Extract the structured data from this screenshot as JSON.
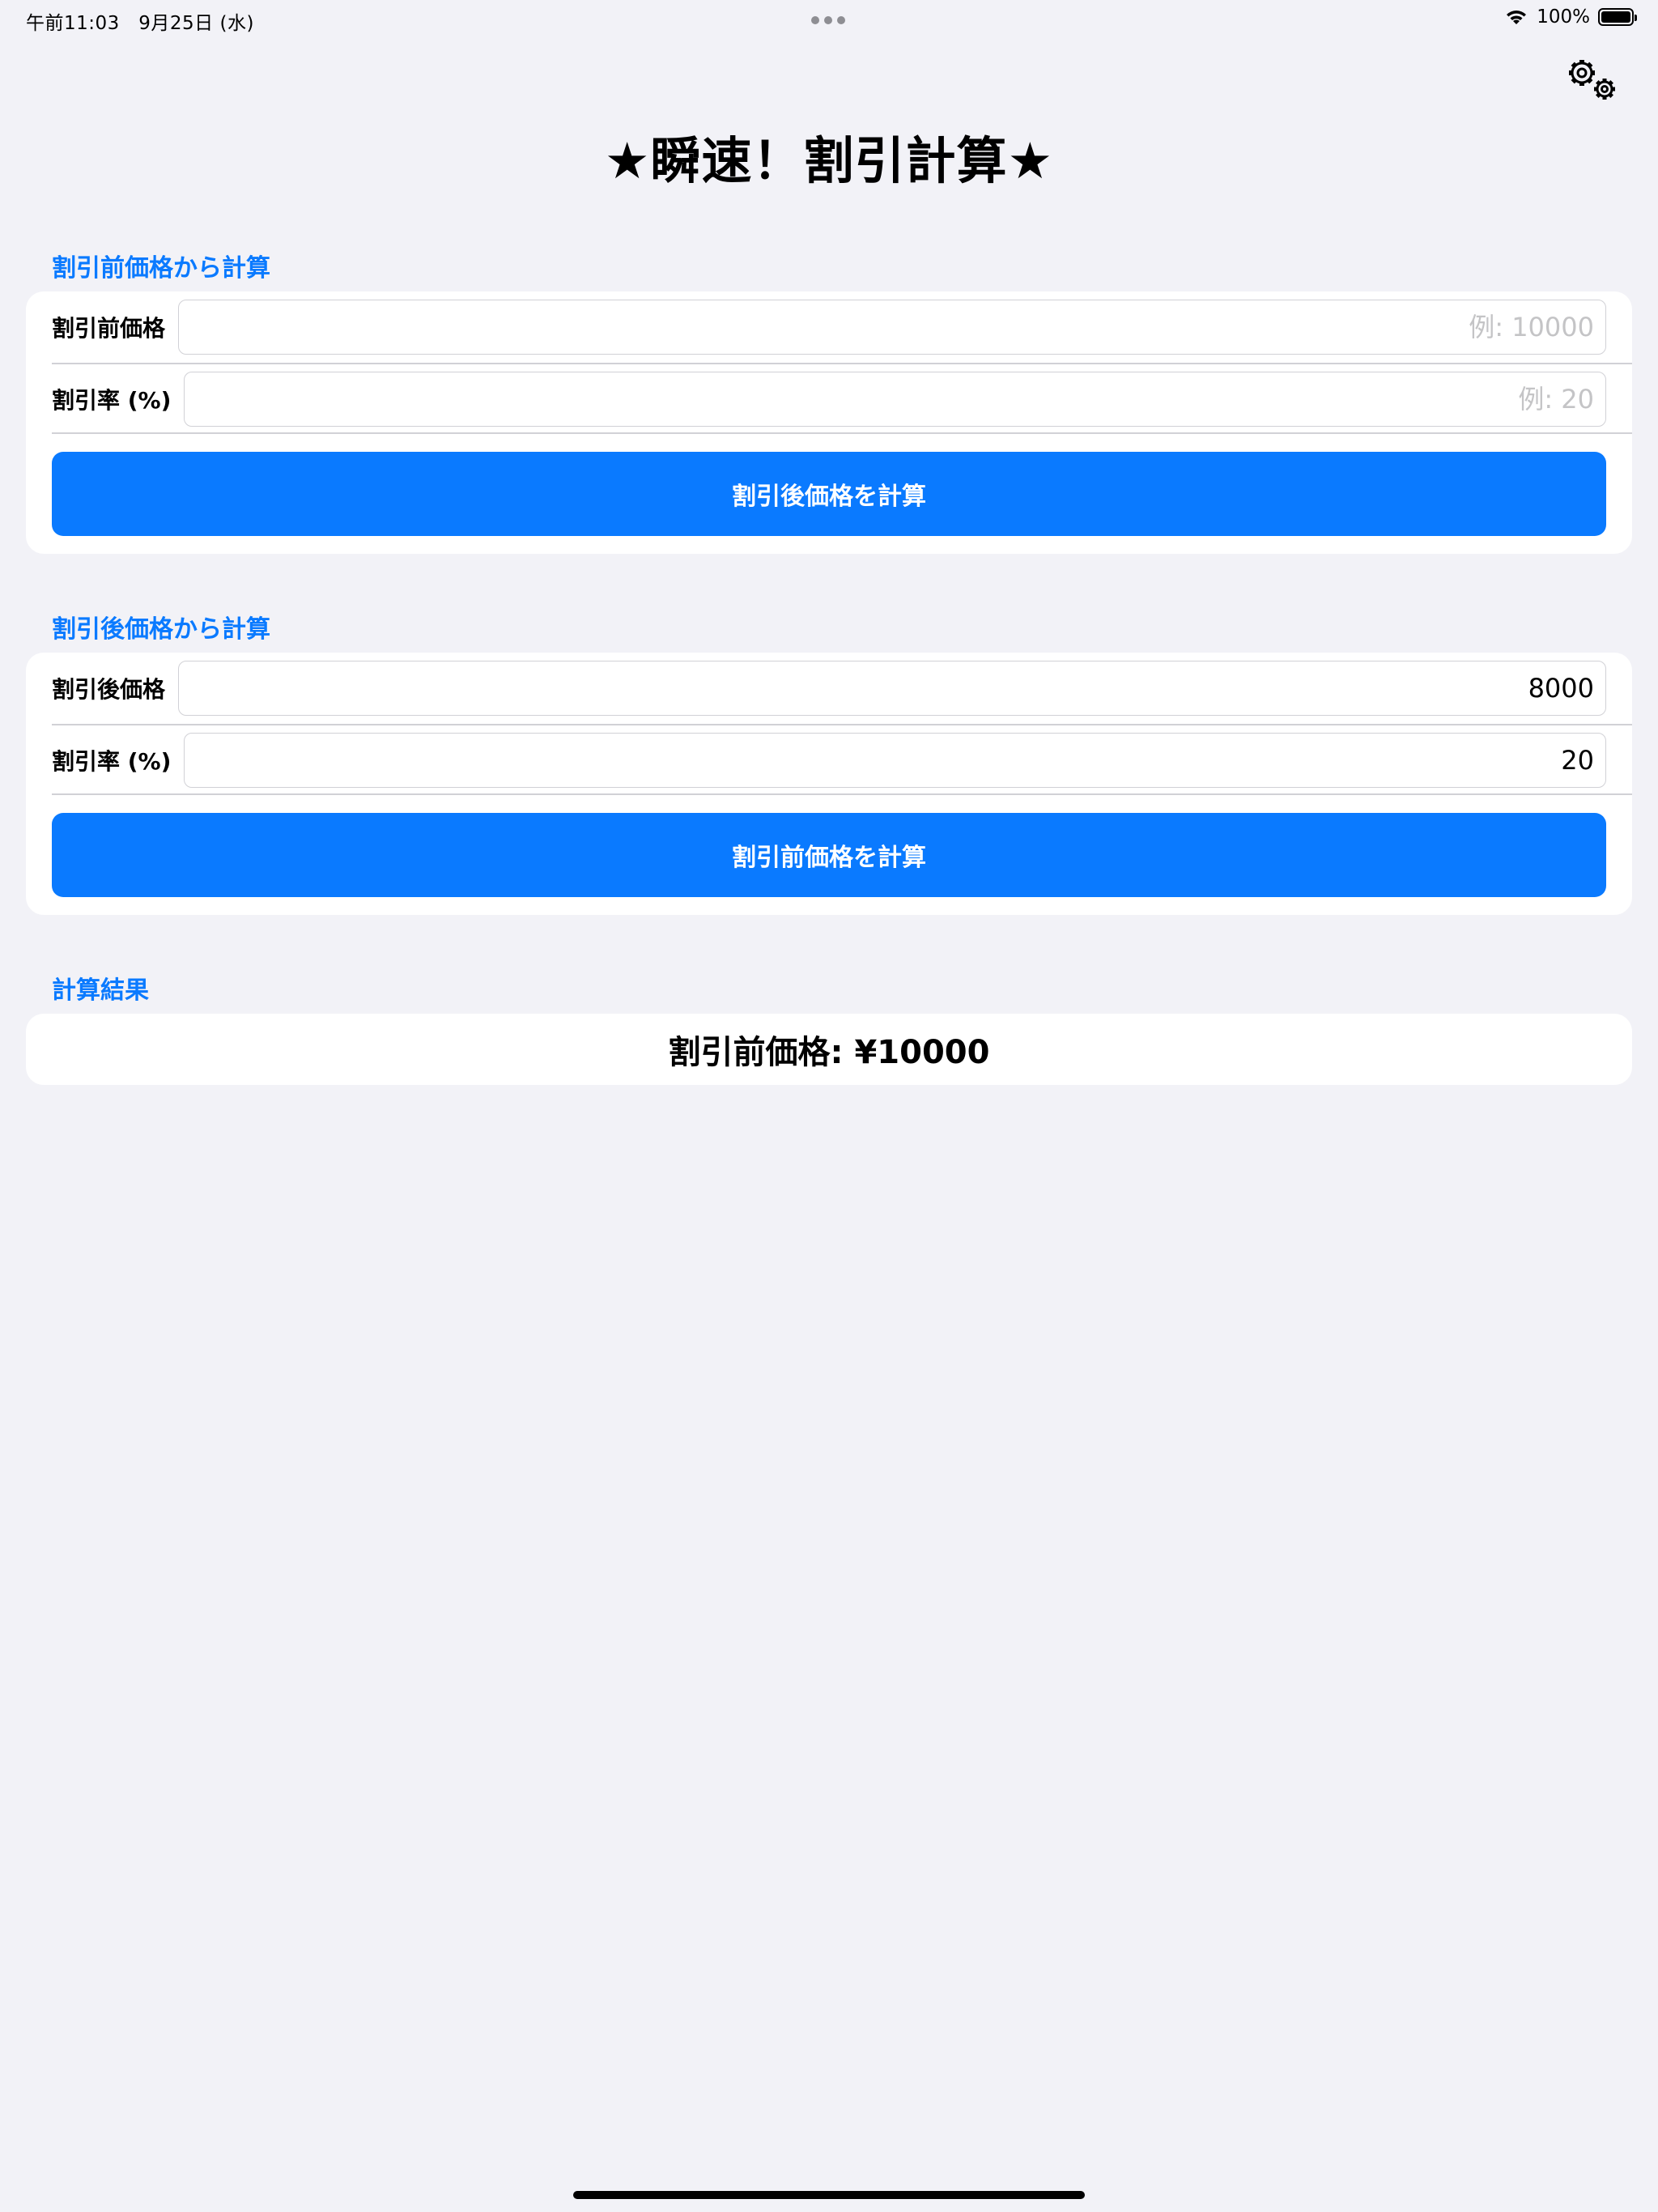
{
  "status_bar": {
    "time": "午前11:03　9月25日 (水)",
    "battery_percent": "100%",
    "battery_level": 1.0
  },
  "title": "★瞬速！割引計算★",
  "icons": {
    "settings": "gear-icon",
    "wifi": "wifi-icon",
    "battery": "battery-icon"
  },
  "section_original": {
    "header": "割引前価格から計算",
    "price_label": "割引前価格",
    "price_placeholder": "例: 10000",
    "price_value": "",
    "rate_label": "割引率 (%)",
    "rate_placeholder": "例: 20",
    "rate_value": "",
    "button_label": "割引後価格を計算"
  },
  "section_discounted": {
    "header": "割引後価格から計算",
    "price_label": "割引後価格",
    "price_value": "8000",
    "rate_label": "割引率 (%)",
    "rate_value": "20",
    "button_label": "割引前価格を計算"
  },
  "result": {
    "header": "計算結果",
    "text": "割引前価格: ¥10000"
  },
  "colors": {
    "accent": "#0a7aff",
    "background": "#f2f2f7",
    "card": "#ffffff"
  }
}
